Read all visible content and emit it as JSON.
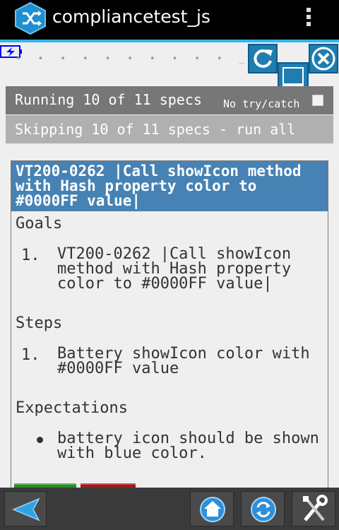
{
  "app": {
    "title": "compliancetest_js"
  },
  "toolbar": {
    "dots": "• • • • • • • • • • _"
  },
  "spec_runner": {
    "running_text": "Running 10 of 11 specs",
    "no_try_catch_label": "No try/catch",
    "no_try_catch_checked": false,
    "skipping_text": "Skipping 10 of 11 specs - run all"
  },
  "spec": {
    "header": "VT200-0262 |Call showIcon method with Hash property color to #0000FF value|",
    "goals_title": "Goals",
    "goals": [
      {
        "num": "1.",
        "text": "VT200-0262 |Call showIcon method with Hash property color to #0000FF value|"
      }
    ],
    "steps_title": "Steps",
    "steps": [
      {
        "num": "1.",
        "text": "Battery showIcon color with #0000FF value"
      }
    ],
    "expectations_title": "Expectations",
    "expectations": [
      {
        "text": "battery icon should be shown with blue color."
      }
    ]
  },
  "colors": {
    "accent": "#33b5e5",
    "header_bg": "#4682b4",
    "button_blue": "#1f7db0",
    "battery_icon": "#0000ff",
    "pass": "#2b8a2b",
    "fail": "#9b1c1c"
  },
  "icons": {
    "app": "shuffle-icon",
    "battery": "battery-charging-icon",
    "reload": "reload-icon",
    "close": "close-icon",
    "minimize": "minimize-icon",
    "back": "back-arrow-icon",
    "home": "home-icon",
    "refresh": "refresh-icon",
    "settings": "wrench-screwdriver-icon"
  }
}
